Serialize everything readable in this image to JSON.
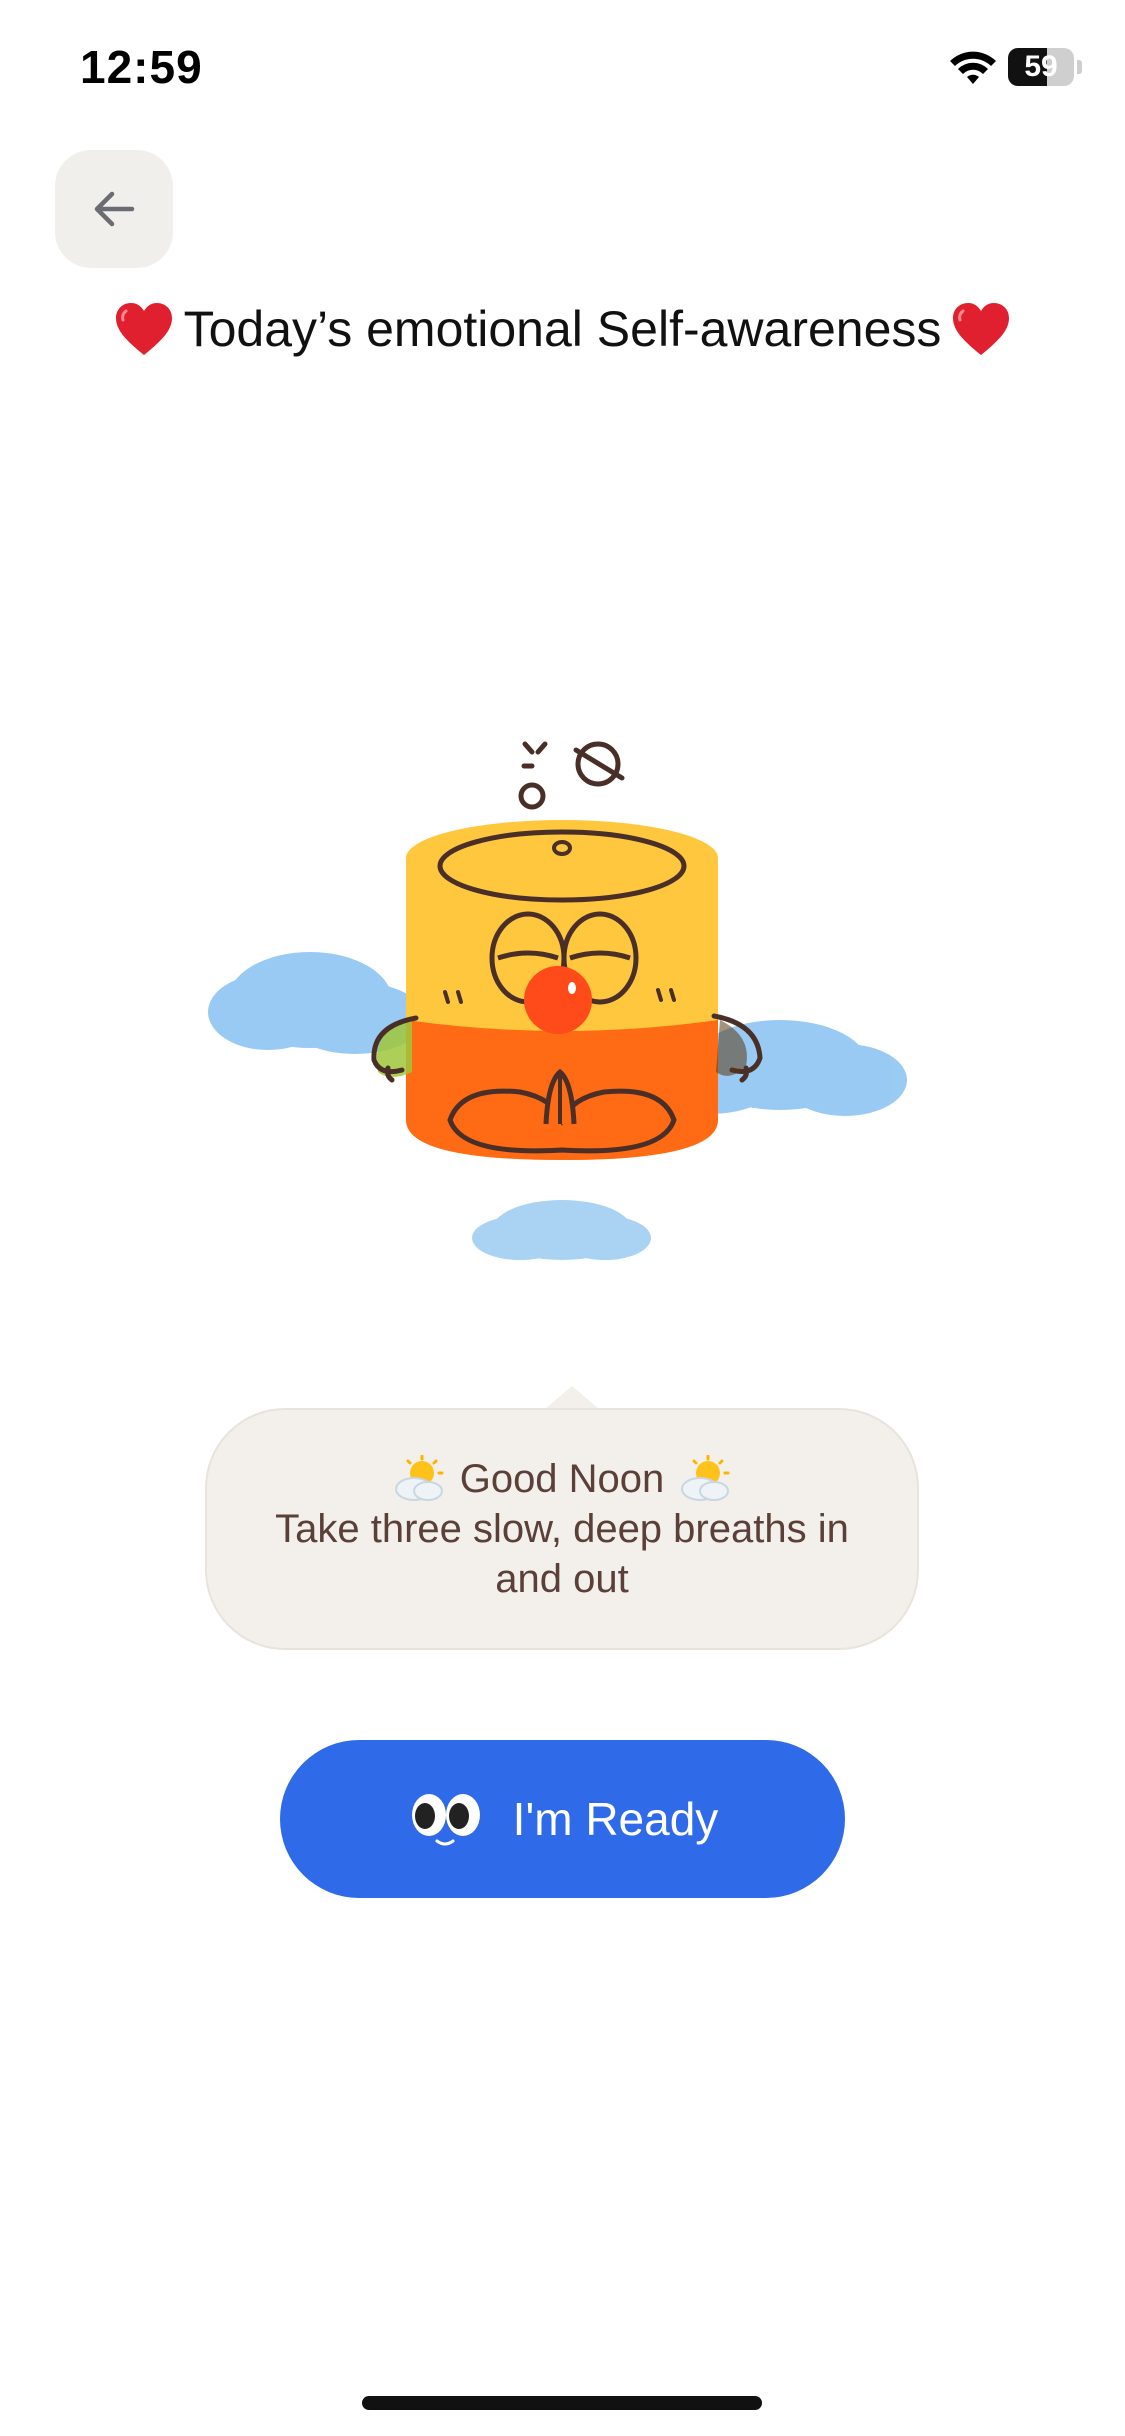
{
  "status_bar": {
    "time": "12:59",
    "battery": "59",
    "battery_level_percent": 59
  },
  "header": {
    "back_icon": "arrow-left-icon",
    "title": "Today’s emotional Self-awareness",
    "title_icon": "red-heart-icon"
  },
  "illustration": {
    "name": "meditating-character-illustration"
  },
  "message": {
    "heading": "Good Noon",
    "heading_icon": "sun-behind-cloud-icon",
    "body": "Take three slow, deep breaths in and out"
  },
  "ready_button": {
    "label": "I'm Ready",
    "icon": "eyes-icon"
  },
  "colors": {
    "accent": "#2f6ae8",
    "bubble_background": "#f3f0eb",
    "bubble_text": "#5a4038",
    "back_button_background": "#f1efec"
  }
}
